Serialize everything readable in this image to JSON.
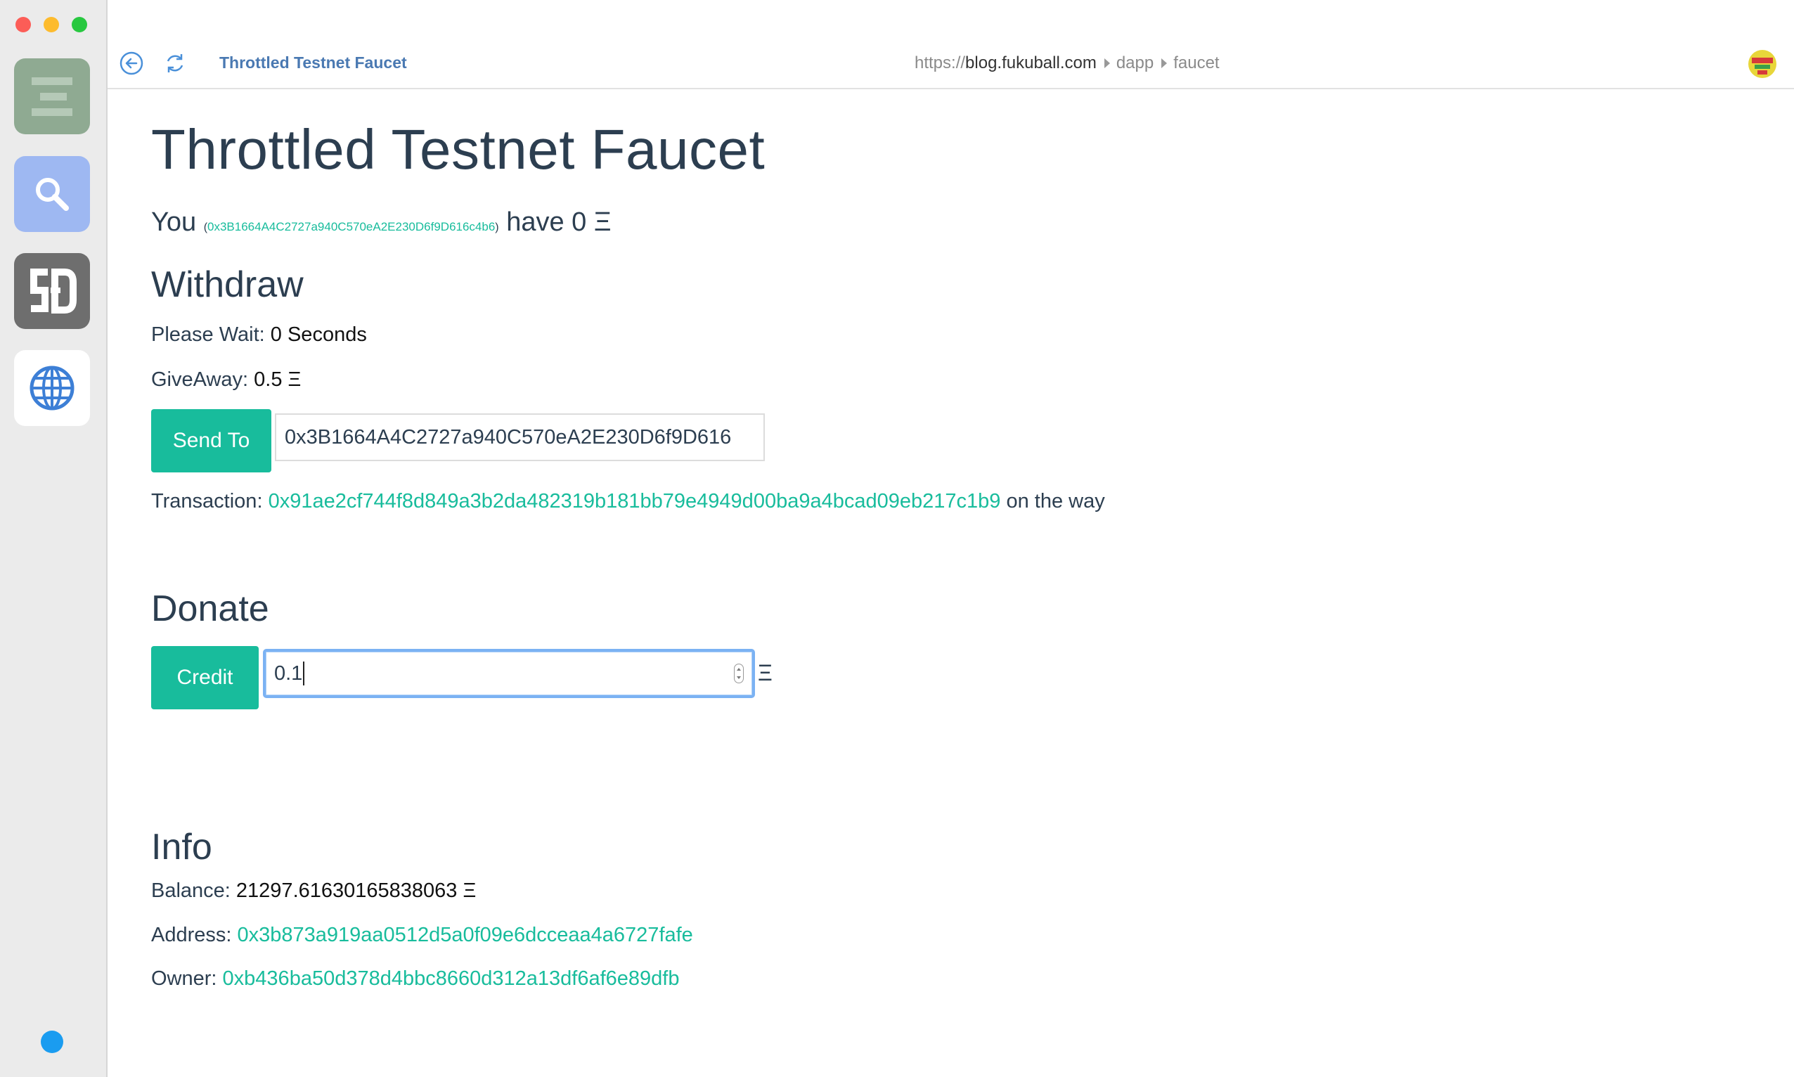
{
  "window": {
    "tab_title": "Throttled Testnet Faucet",
    "url": {
      "scheme": "https://",
      "host": "blog.fukuball.com",
      "crumbs": [
        "dapp",
        "faucet"
      ]
    }
  },
  "sidebar": {
    "apps": [
      {
        "name": "ether-wallet",
        "icon": "ether-icon"
      },
      {
        "name": "search",
        "icon": "search-icon"
      },
      {
        "name": "sd",
        "icon": "sd-logo-icon"
      },
      {
        "name": "browser",
        "icon": "globe-icon"
      }
    ],
    "status_color": "#1a9cf0"
  },
  "page": {
    "title": "Throttled Testnet Faucet",
    "you": {
      "prefix": "You",
      "open_paren": "(",
      "address": "0x3B1664A4C2727a940C570eA2E230D6f9D616c4b6",
      "close_paren": ")",
      "have": "have 0 Ξ"
    },
    "withdraw": {
      "heading": "Withdraw",
      "wait_label": "Please Wait:",
      "wait_value": "0 Seconds",
      "giveaway_label": "GiveAway:",
      "giveaway_value": "0.5 Ξ",
      "send_button": "Send To",
      "send_address": "0x3B1664A4C2727a940C570eA2E230D6f9D616",
      "tx_label": "Transaction:",
      "tx_hash": "0x91ae2cf744f8d849a3b2da482319b181bb79e4949d00ba9a4bcad09eb217c1b9",
      "tx_suffix": "on the way"
    },
    "donate": {
      "heading": "Donate",
      "credit_button": "Credit",
      "amount": "0.1",
      "unit": "Ξ"
    },
    "info": {
      "heading": "Info",
      "balance_label": "Balance:",
      "balance_value": "21297.61630165838063 Ξ",
      "address_label": "Address:",
      "address_value": "0x3b873a919aa0512d5a0f09e6dcceaa4a6727fafe",
      "owner_label": "Owner:",
      "owner_value": "0xb436ba50d378d4bbc8660d312a13df6af6e89dfb"
    }
  },
  "colors": {
    "accent": "#18bc9c",
    "text": "#2c3e50",
    "tab_title": "#4a79b2",
    "focus_ring": "#7bb2f3"
  }
}
